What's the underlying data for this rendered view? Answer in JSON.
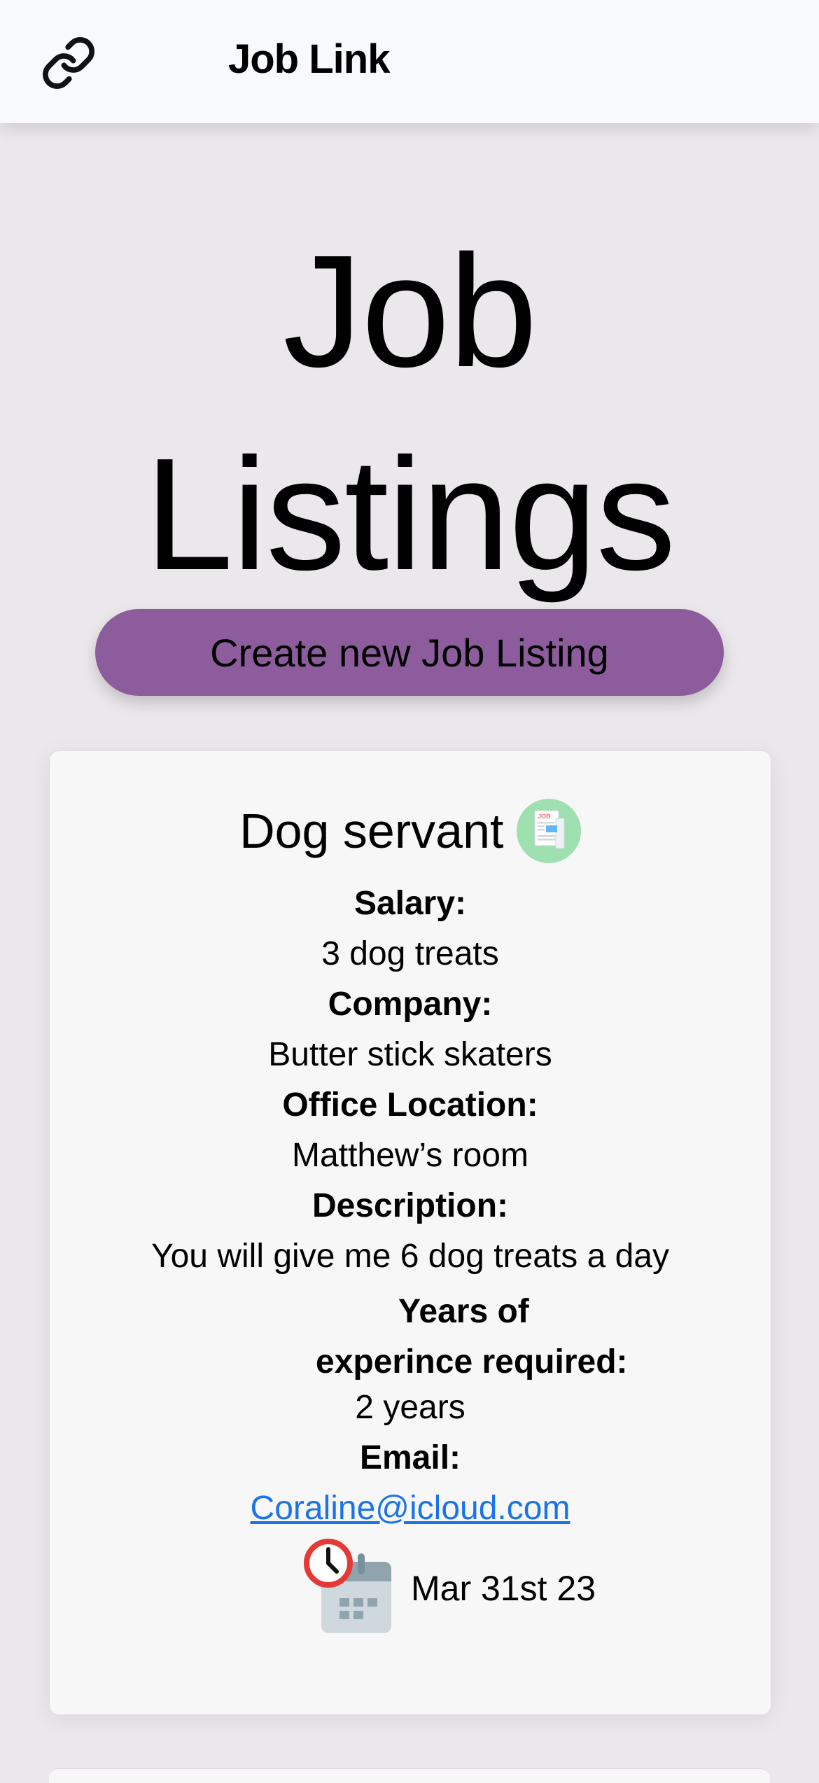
{
  "nav": {
    "brand": "Job Link",
    "logo_icon": "link-icon"
  },
  "page": {
    "title": "Job Listings",
    "create_button_label": "Create new Job Listing"
  },
  "colors": {
    "nav_bg": "#f8f9fb",
    "page_bg": "#ebe8ec",
    "button_bg": "#8c5c9c",
    "card_bg": "#f7f7f8",
    "link": "#1a73e8",
    "icon_circle": "#9ee0b0",
    "clock_ring": "#e53935"
  },
  "listings": [
    {
      "title": "Dog servant",
      "title_icon": "job-newspaper-icon",
      "salary_label": "Salary:",
      "salary": "3 dog treats",
      "company_label": "Company:",
      "company": "Butter stick skaters",
      "location_label": "Office Location:",
      "location": "Matthew’s room",
      "description_label": "Description:",
      "description": "You will give me 6 dog treats a day",
      "experience_label": "Years of experince required:",
      "experience": "2 years",
      "email_label": "Email:",
      "email": "Coraline@icloud.com",
      "date_icon": "calendar-clock-icon",
      "date": "Mar 31st 23",
      "icon_text": "JOB"
    }
  ]
}
